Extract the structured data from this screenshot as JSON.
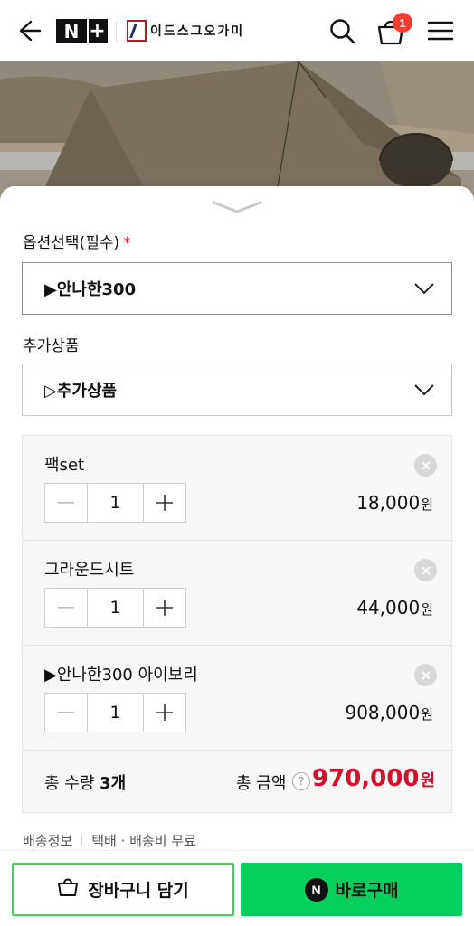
{
  "header": {
    "logo_n": "N",
    "logo_plus": "+",
    "brand_name": "이드스그오가미",
    "cart_count": "1"
  },
  "option": {
    "label": "옵션선택(필수)",
    "required_mark": "*",
    "selected": "▶안나한300"
  },
  "addon": {
    "label": "추가상품",
    "selected": "▷추가상품"
  },
  "items": [
    {
      "name": "팩set",
      "qty": "1",
      "price": "18,000",
      "unit": "원"
    },
    {
      "name": "그라운드시트",
      "qty": "1",
      "price": "44,000",
      "unit": "원"
    },
    {
      "name": "▶안나한300 아이보리",
      "qty": "1",
      "price": "908,000",
      "unit": "원"
    }
  ],
  "total": {
    "qty_label": "총 수량",
    "qty_value": "3개",
    "amount_label": "총 금액",
    "help": "?",
    "amount": "970,000",
    "unit": "원"
  },
  "shipping": {
    "label": "배송정보",
    "info": "택배 · 배송비 무료"
  },
  "buttons": {
    "cart": "장바구니 담기",
    "buy_icon": "N",
    "buy": "바로구매"
  },
  "colors": {
    "accent_green": "#03cf5d",
    "price_red": "#d3112b",
    "badge_red": "#ff3b30"
  }
}
